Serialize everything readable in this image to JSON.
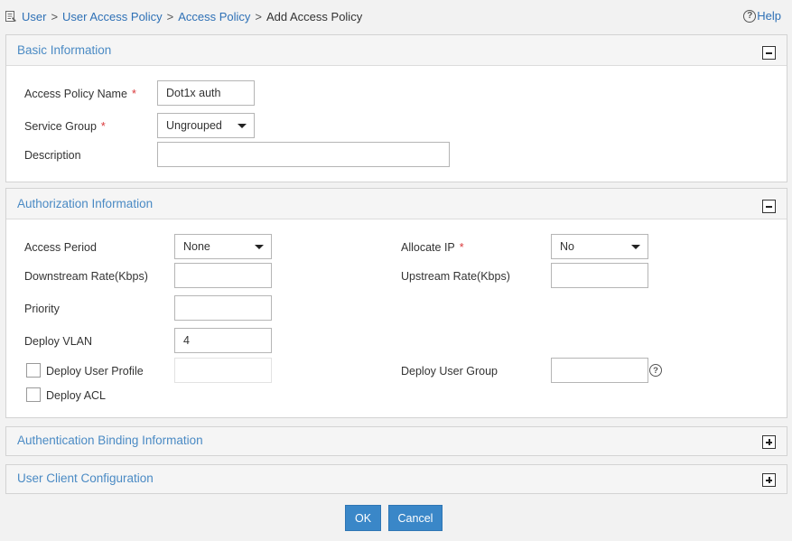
{
  "breadcrumb": {
    "items": [
      "User",
      "User Access Policy",
      "Access Policy"
    ],
    "separator": ">",
    "current": "Add Access Policy"
  },
  "help": {
    "label": "Help"
  },
  "basic": {
    "title": "Basic Information",
    "toggle": "collapse",
    "name_label": "Access Policy Name",
    "name_value": "Dot1x auth",
    "service_group_label": "Service Group",
    "service_group_value": "Ungrouped",
    "description_label": "Description",
    "description_value": "",
    "required_mark": "*"
  },
  "auth": {
    "title": "Authorization Information",
    "toggle": "collapse",
    "access_period_label": "Access Period",
    "access_period_value": "None",
    "allocate_ip_label": "Allocate IP",
    "allocate_ip_value": "No",
    "downstream_label": "Downstream Rate(Kbps)",
    "downstream_value": "",
    "upstream_label": "Upstream Rate(Kbps)",
    "upstream_value": "",
    "priority_label": "Priority",
    "priority_value": "",
    "vlan_label": "Deploy VLAN",
    "vlan_value": "4",
    "user_profile_label": "Deploy User Profile",
    "user_profile_checked": false,
    "user_group_label": "Deploy User Group",
    "user_group_value": "",
    "acl_label": "Deploy ACL",
    "acl_checked": false,
    "required_mark": "*"
  },
  "binding": {
    "title": "Authentication Binding Information",
    "toggle": "expand"
  },
  "client": {
    "title": "User Client Configuration",
    "toggle": "expand"
  },
  "actions": {
    "ok": "OK",
    "cancel": "Cancel"
  },
  "colors": {
    "accent": "#3a87c8",
    "title": "#4a8ac4",
    "link": "#2f71b6",
    "required": "#d9383a"
  },
  "icons": {
    "help": "question-circle-icon",
    "collapse": "minus-box-icon",
    "expand": "plus-box-icon",
    "breadcrumb": "document-icon"
  }
}
